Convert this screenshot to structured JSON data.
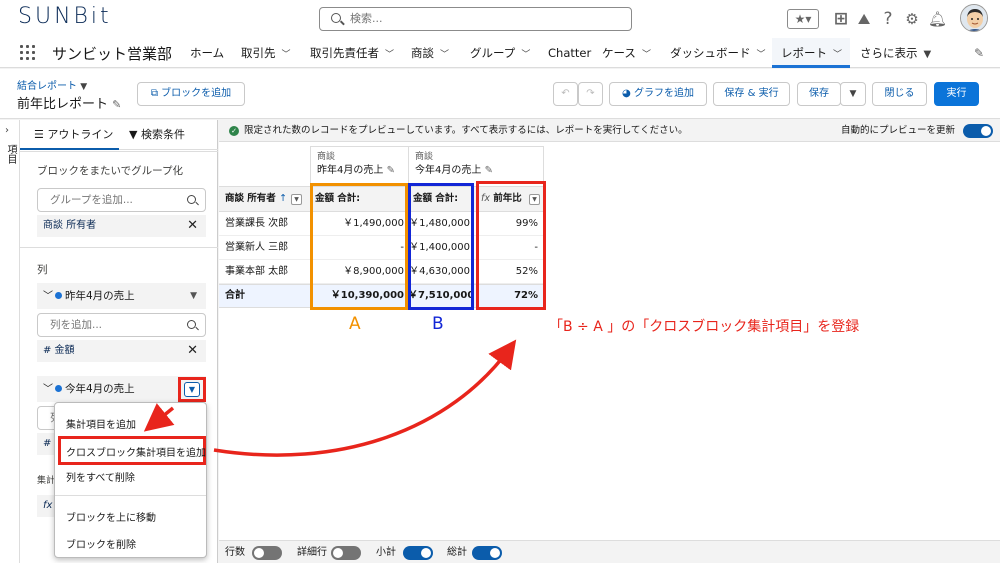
{
  "header": {
    "logo": "SUNBit",
    "search_placeholder": "検索...",
    "app_name": "サンビット営業部",
    "nav": [
      "ホーム",
      "取引先",
      "取引先責任者",
      "商談",
      "グループ",
      "Chatter",
      "ケース",
      "ダッシュボード",
      "レポート",
      "さらに表示"
    ]
  },
  "page": {
    "report_type": "結合レポート",
    "title": "前年比レポート",
    "add_block": "ブロックを追加",
    "buttons": {
      "graph": "グラフを追加",
      "save_run": "保存 & 実行",
      "save": "保存",
      "close": "閉じる",
      "run": "実行"
    }
  },
  "rail": {
    "label": "項目"
  },
  "panel": {
    "tabs": [
      "アウトライン",
      "検索条件"
    ],
    "group_across": "ブロックをまたいでグループ化",
    "group_placeholder": "グループを追加...",
    "group_item": "商談 所有者",
    "columns_label": "列",
    "block1": {
      "name": "昨年4月の売上",
      "placeholder": "列を追加...",
      "field": "# 金額"
    },
    "block2": {
      "name": "今年4月の売上",
      "placeholder": "列",
      "field": "#"
    },
    "aggregate_label": "集計",
    "fx": "fx"
  },
  "menu": {
    "items": [
      "集計項目を追加",
      "クロスブロック集計項目を追加",
      "列をすべて削除",
      "ブロックを上に移動",
      "ブロックを削除"
    ]
  },
  "info": {
    "message": "限定された数のレコードをプレビューしています。すべて表示するには、レポートを実行してください。",
    "auto_preview": "自動的にプレビューを更新"
  },
  "table": {
    "block1_type": "商談",
    "block1_name": "昨年4月の売上",
    "block2_type": "商談",
    "block2_name": "今年4月の売上",
    "col_owner": "商談 所有者",
    "col_sum1": "金額 合計:",
    "col_sum2": "金額 合計:",
    "col_yoy": "前年比",
    "fx": "fx",
    "rows": [
      {
        "owner": "営業課長 次郎",
        "a": "￥1,490,000",
        "b": "￥1,480,000",
        "c": "99%"
      },
      {
        "owner": "営業新人 三郎",
        "a": "-",
        "b": "￥1,400,000",
        "c": "-"
      },
      {
        "owner": "事業本部 太郎",
        "a": "￥8,900,000",
        "b": "￥4,630,000",
        "c": "52%"
      }
    ],
    "total": {
      "owner": "合計",
      "a": "￥10,390,000",
      "b": "￥7,510,000",
      "c": "72%"
    }
  },
  "annotation": {
    "a": "A",
    "b": "B",
    "note": "「B ÷ A 」の「クロスブロック集計項目」を登録",
    "colors": {
      "orange": "#f29100",
      "blue": "#1226d6",
      "red": "#e8251c"
    }
  },
  "footer": {
    "toggles": [
      {
        "label": "行数",
        "on": false
      },
      {
        "label": "詳細行",
        "on": false
      },
      {
        "label": "小計",
        "on": true
      },
      {
        "label": "総計",
        "on": true
      }
    ]
  }
}
